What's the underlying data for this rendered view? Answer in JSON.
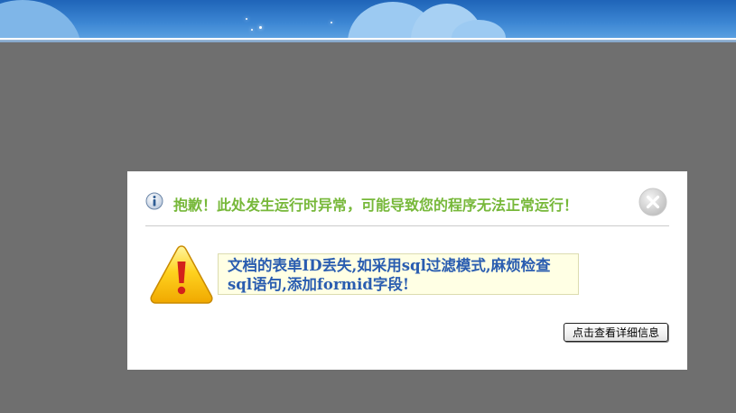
{
  "dialog": {
    "title": "抱歉！此处发生运行时异常，可能导致您的程序无法正常运行！",
    "message": "文档的表单ID丢失,如采用sql过滤模式,麻烦检查sql语句,添加formid字段!",
    "detail_button_label": "点击查看详细信息",
    "info_icon": "info-icon",
    "warning_icon": "warning-icon",
    "close_icon": "close-icon"
  },
  "colors": {
    "title": "#77b83a",
    "message_text": "#2a5db0",
    "message_background": "#ffffe4",
    "overlay": "#6f6f6f",
    "banner": "#3c86d3"
  }
}
